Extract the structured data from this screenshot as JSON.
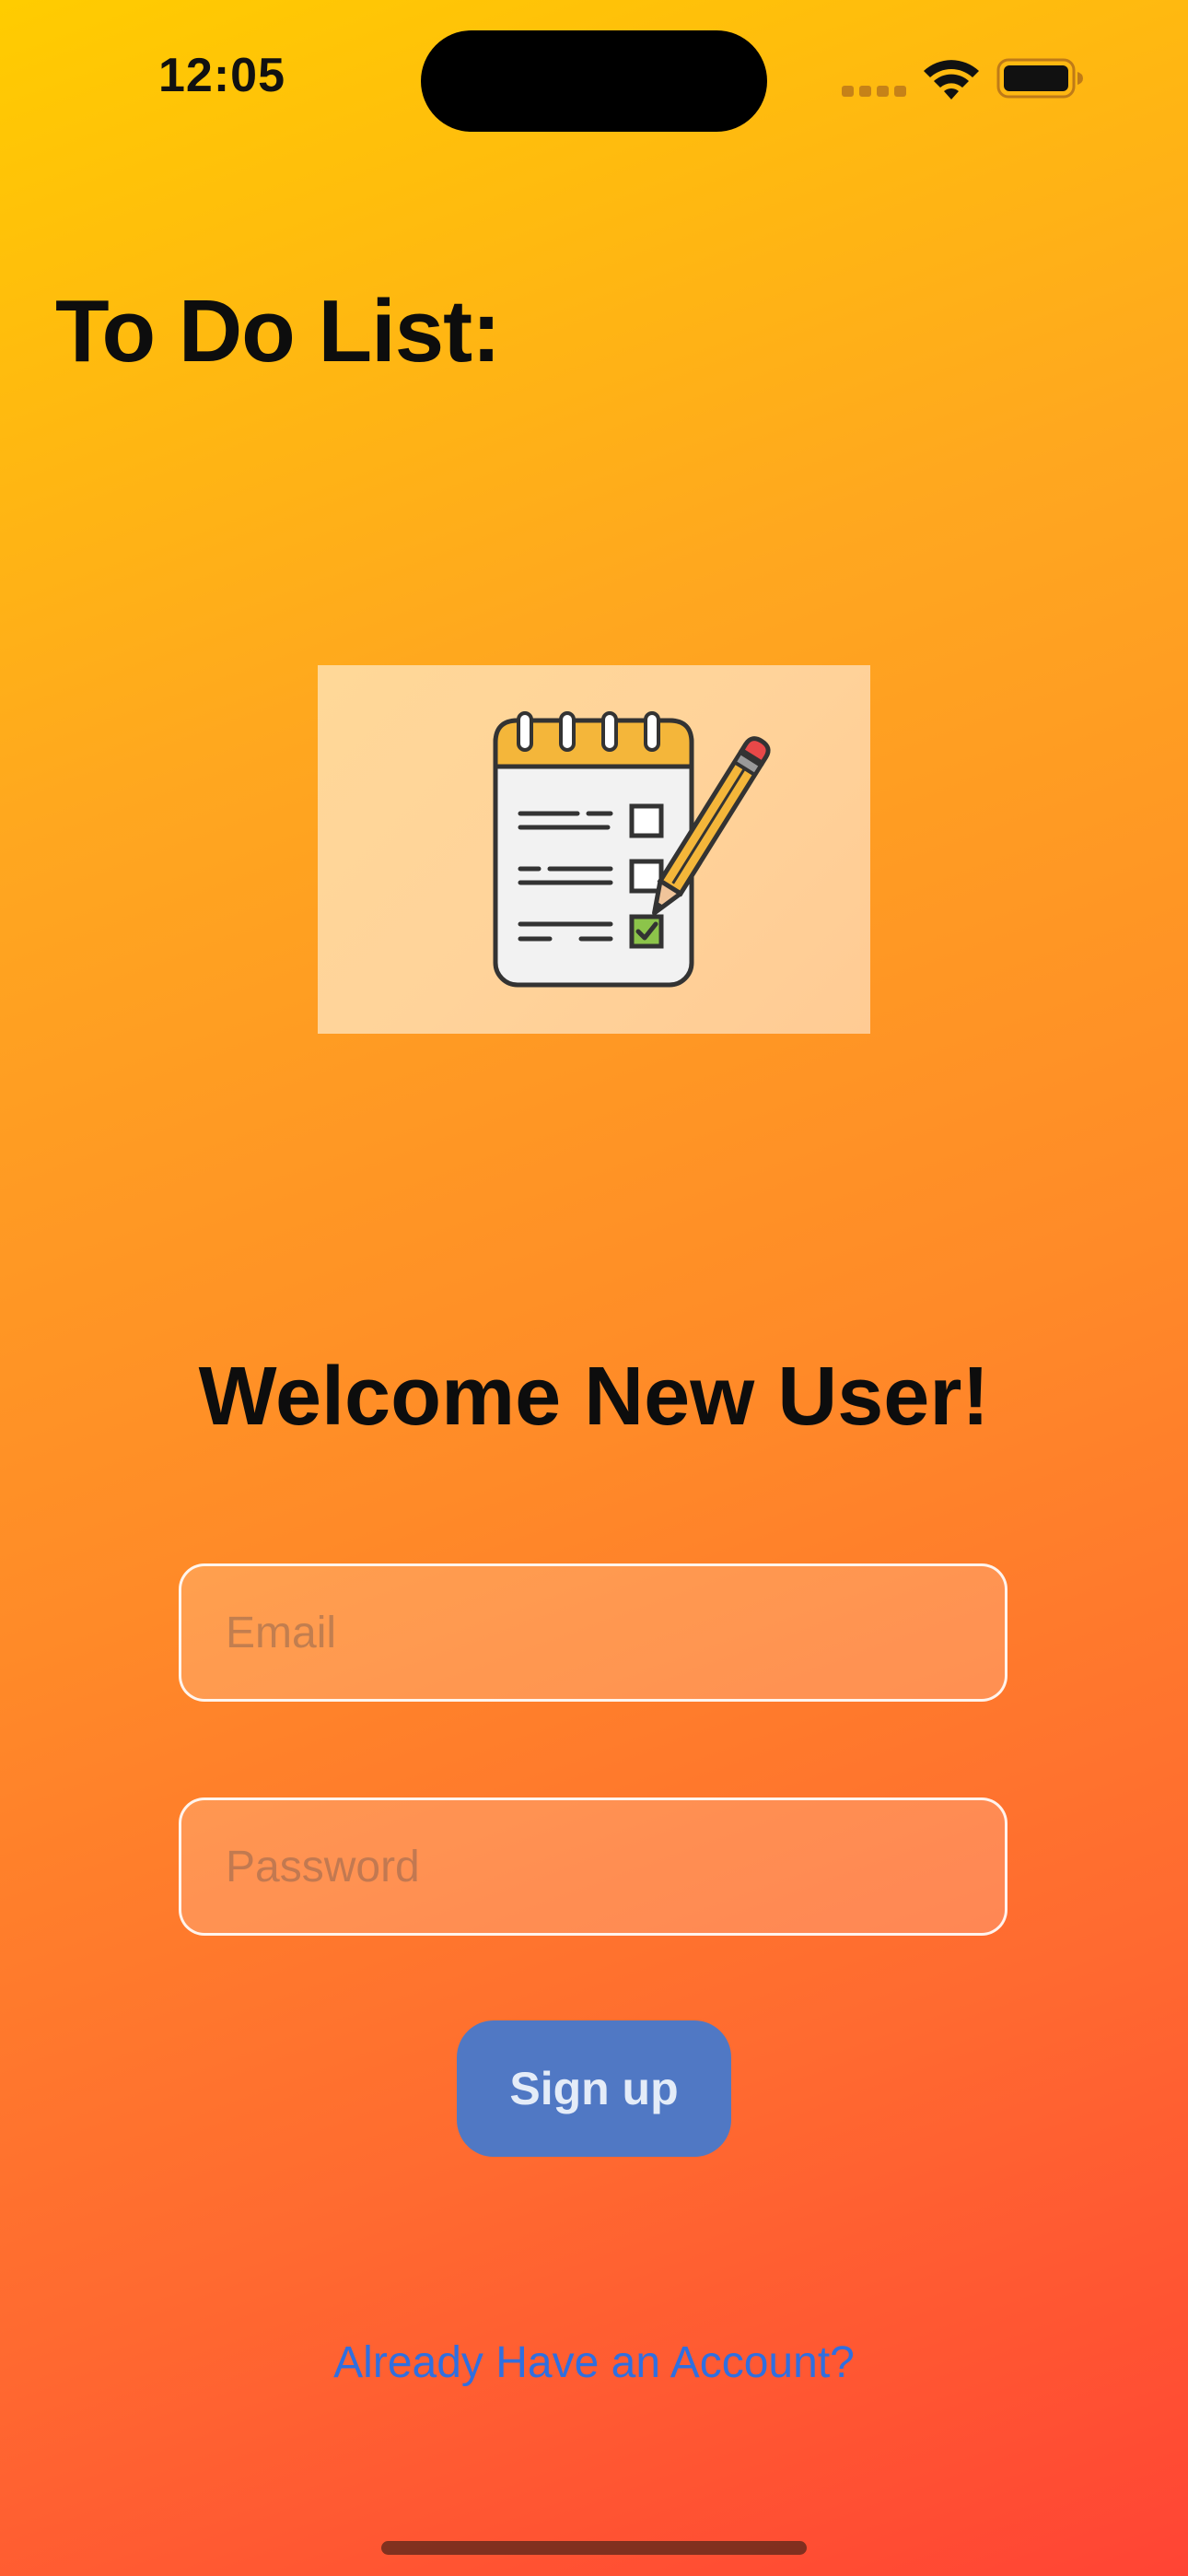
{
  "status_bar": {
    "time": "12:05",
    "icons": [
      "cellular-signal-icon",
      "wifi-icon",
      "battery-icon"
    ]
  },
  "page": {
    "title": "To Do List:",
    "hero_image": "notepad-checklist-with-pencil-illustration"
  },
  "signup": {
    "heading": "Welcome New User!",
    "email": {
      "value": "",
      "placeholder": "Email"
    },
    "password": {
      "value": "",
      "placeholder": "Password"
    },
    "submit_label": "Sign up",
    "login_link": "Already Have an Account?"
  },
  "colors": {
    "gradient_top": "#ffcc00",
    "gradient_bottom": "#ff4434",
    "button": "#5078c4",
    "link": "#2f6fe0",
    "notepad_header": "#f4b63a",
    "checked_box": "#8cc44a"
  }
}
